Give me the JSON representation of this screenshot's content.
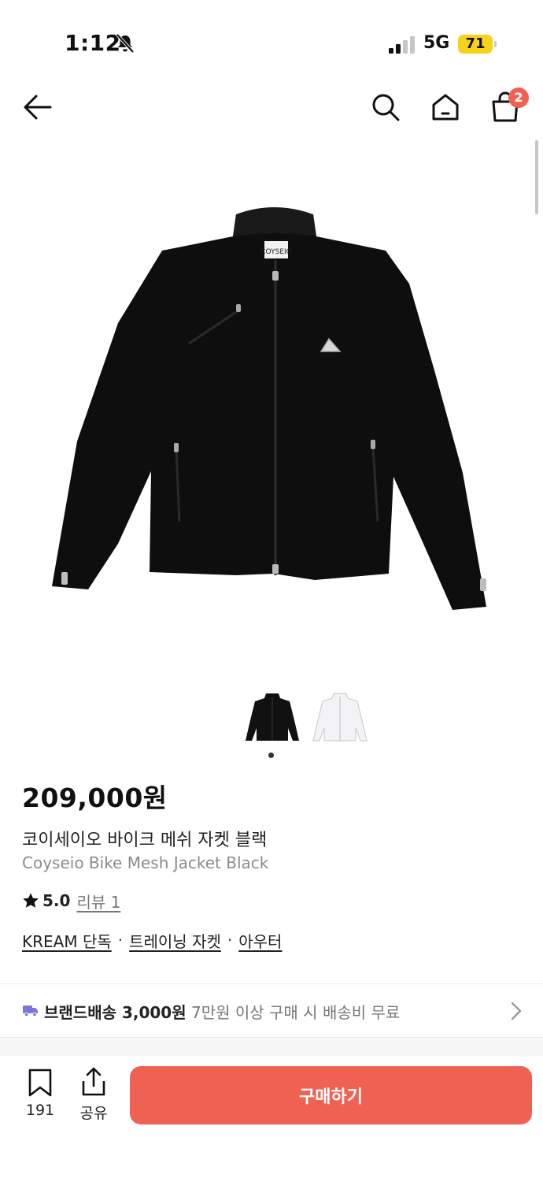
{
  "status_bar": {
    "time": "1:12",
    "network": "5G",
    "battery": "71",
    "signal_bars_active": 2,
    "signal_bars_total": 4
  },
  "nav": {
    "cart_count": "2"
  },
  "gallery": {
    "total_images": 2,
    "active_index": 0,
    "thumbnail_colors": [
      "#111111",
      "#f3f3f5"
    ],
    "label_on_jacket": "COYSEIO"
  },
  "product": {
    "price": "209,000원",
    "name_ko": "코이세이오 바이크 메쉬 자켓 블랙",
    "name_en": "Coyseio Bike Mesh Jacket Black",
    "rating": "5.0",
    "review_link": "리뷰 1",
    "categories": [
      "KREAM 단독",
      "트레이닝 자켓",
      "아우터"
    ],
    "category_separator": "·"
  },
  "shipping": {
    "title": "브랜드배송 3,000원",
    "detail": "7만원 이상 구매 시 배송비 무료"
  },
  "bottom_bar": {
    "bookmark_count": "191",
    "share_label": "공유",
    "buy_label": "구매하기"
  },
  "colors": {
    "accent": "#ef6253",
    "battery": "#f6d21a",
    "truck": "#7b74d9",
    "muted_text": "#8b8b8b"
  },
  "icons": [
    "bell-off-icon",
    "signal-icon",
    "back-arrow-icon",
    "search-icon",
    "home-icon",
    "shopping-bag-icon",
    "star-icon",
    "truck-icon",
    "chevron-right-icon",
    "bookmark-icon",
    "share-icon"
  ]
}
